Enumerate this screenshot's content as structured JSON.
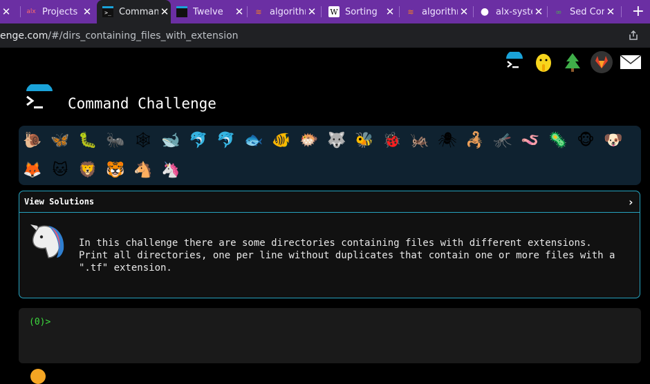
{
  "browser": {
    "tabs": [
      {
        "title": "",
        "favicon": "",
        "active": false
      },
      {
        "title": "Projects",
        "favicon": "alx",
        "active": false
      },
      {
        "title": "Command",
        "favicon": ">_",
        "active": true
      },
      {
        "title": "Twelve",
        "favicon": "🌲",
        "active": false
      },
      {
        "title": "algorithm",
        "favicon": "≋",
        "active": false
      },
      {
        "title": "Sorting",
        "favicon": "W",
        "active": false
      },
      {
        "title": "algorithm",
        "favicon": "≋",
        "active": false
      },
      {
        "title": "alx-syste",
        "favicon": "●",
        "active": false
      },
      {
        "title": "Sed Con",
        "favicon": "∞",
        "active": false
      }
    ],
    "new_tab": "+",
    "close_glyph": "✕",
    "url_host": "enge.com",
    "url_path": "/#/dirs_containing_files_with_extension"
  },
  "top_icons": [
    "terminal-icon",
    "shushing-face-icon",
    "tree-icon",
    "gitlab-icon",
    "mail-icon"
  ],
  "title": "Command Challenge",
  "animals": [
    "🐌",
    "🦋",
    "🐛",
    "🐜",
    "🕸",
    "🐋",
    "🐬",
    "🐬",
    "🐟",
    "🐠",
    "🐡",
    "🐺",
    "🐝",
    "🐞",
    "🦗",
    "🕷",
    "🦂",
    "🦟",
    "🪱",
    "🦠",
    "🐵",
    "🐶",
    "🦊",
    "🐱",
    "🦁",
    "🐯",
    "🐴",
    "🦄"
  ],
  "solutions": {
    "header": "View Solutions",
    "chevron": "›",
    "lines": [
      "In this challenge there are some directories containing files with different extensions.",
      "Print all directories, one per line without duplicates that contain one or more files with a",
      "\".tf\" extension."
    ]
  },
  "terminal": {
    "prompt": "(0)>"
  },
  "colors": {
    "tab_bar": "#6b2fa3",
    "card_border": "#26a4c1",
    "animals_bg": "#0f2230",
    "prompt_green": "#3ddc3d"
  }
}
